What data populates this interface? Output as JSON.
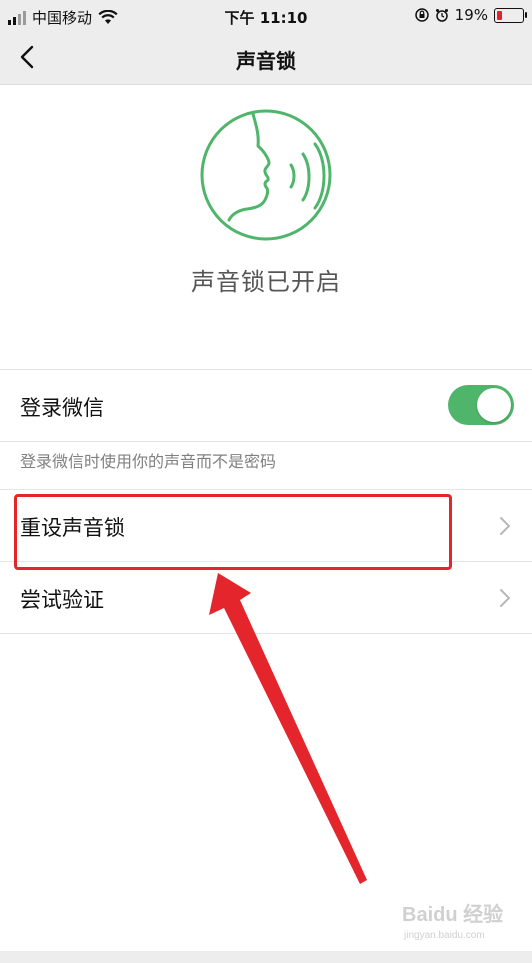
{
  "status": {
    "carrier": "中国移动",
    "time": "下午 11:10",
    "battery": "19%",
    "battery_level": 0.19
  },
  "nav": {
    "title": "声音锁"
  },
  "hero": {
    "text": "声音锁已开启",
    "icon": "face-voice-icon"
  },
  "rows": {
    "login": {
      "label": "登录微信",
      "toggle_on": true
    },
    "hint": "登录微信时使用你的声音而不是密码",
    "reset": {
      "label": "重设声音锁"
    },
    "test": {
      "label": "尝试验证"
    }
  },
  "colors": {
    "accent": "#4fb56a",
    "highlight": "#e4252b"
  },
  "watermark": {
    "brand": "Baidu 经验",
    "url": "jingyan.baidu.com"
  }
}
